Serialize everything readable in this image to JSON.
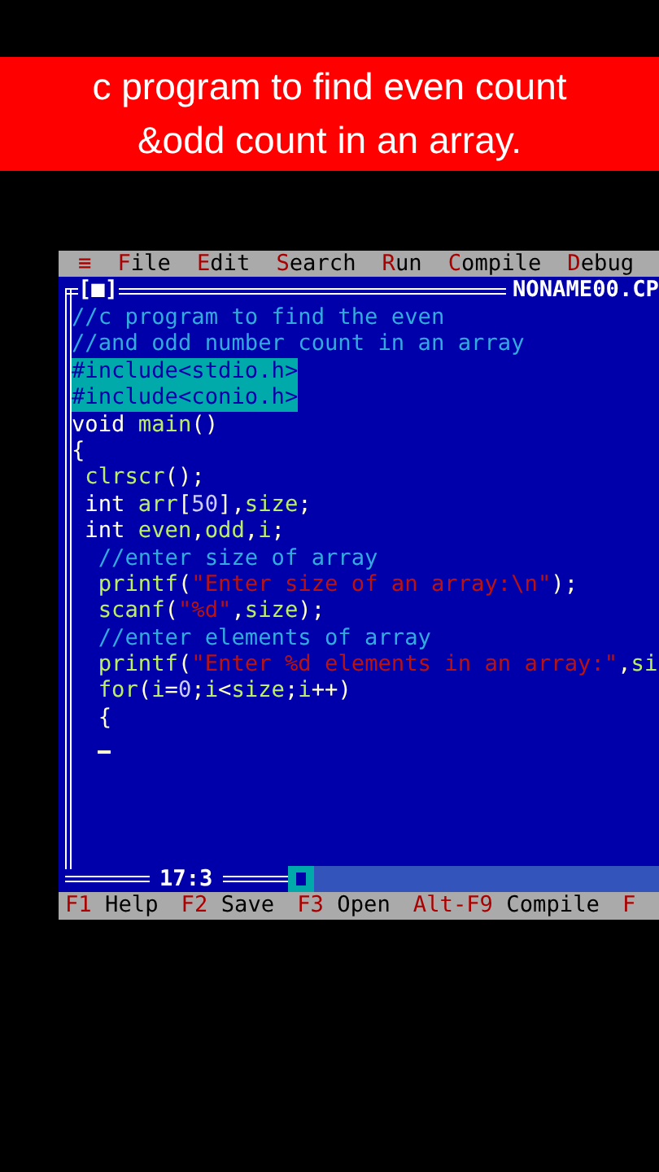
{
  "banner": {
    "lines": [
      "c program to find even count",
      "&odd count in an array."
    ]
  },
  "menu": [
    {
      "hot": "≡"
    },
    {
      "hot": "F",
      "rest": "ile"
    },
    {
      "hot": "E",
      "rest": "dit"
    },
    {
      "hot": "S",
      "rest": "earch"
    },
    {
      "hot": "R",
      "rest": "un"
    },
    {
      "hot": "C",
      "rest": "ompile"
    },
    {
      "hot": "D",
      "rest": "ebug"
    }
  ],
  "editor": {
    "close_box": "[■]",
    "file_name": "NONAME00.CP",
    "position": "17:3",
    "cursor_visible": true,
    "lines": [
      {
        "selected": false,
        "segments": [
          {
            "kind": "com",
            "text": "//c program to find the even"
          }
        ]
      },
      {
        "selected": false,
        "segments": [
          {
            "kind": "com",
            "text": "//and odd number count in an array"
          }
        ]
      },
      {
        "selected": true,
        "segments": [
          {
            "kind": "com",
            "text": "#include<stdio.h>"
          }
        ]
      },
      {
        "selected": true,
        "segments": [
          {
            "kind": "com",
            "text": "#include<conio.h>"
          }
        ]
      },
      {
        "selected": false,
        "segments": [
          {
            "kind": "kw",
            "text": "void "
          },
          {
            "kind": "id",
            "text": "main"
          },
          {
            "kind": "sym",
            "text": "()"
          }
        ]
      },
      {
        "selected": false,
        "segments": [
          {
            "kind": "sym",
            "text": "{"
          }
        ]
      },
      {
        "selected": false,
        "segments": [
          {
            "kind": "id",
            "text": " clrscr"
          },
          {
            "kind": "sym",
            "text": "();"
          }
        ]
      },
      {
        "selected": false,
        "segments": [
          {
            "kind": "kw",
            "text": " int "
          },
          {
            "kind": "id",
            "text": "arr"
          },
          {
            "kind": "sym",
            "text": "["
          },
          {
            "kind": "num",
            "text": "50"
          },
          {
            "kind": "sym",
            "text": "],"
          },
          {
            "kind": "id",
            "text": "size"
          },
          {
            "kind": "sym",
            "text": ";"
          }
        ]
      },
      {
        "selected": false,
        "segments": [
          {
            "kind": "kw",
            "text": " int "
          },
          {
            "kind": "id",
            "text": "even"
          },
          {
            "kind": "sym",
            "text": ","
          },
          {
            "kind": "id",
            "text": "odd"
          },
          {
            "kind": "sym",
            "text": ","
          },
          {
            "kind": "id",
            "text": "i"
          },
          {
            "kind": "sym",
            "text": ";"
          }
        ]
      },
      {
        "selected": false,
        "segments": [
          {
            "kind": "com",
            "text": "  //enter size of array"
          }
        ]
      },
      {
        "selected": false,
        "segments": [
          {
            "kind": "id",
            "text": "  printf"
          },
          {
            "kind": "sym",
            "text": "("
          },
          {
            "kind": "str",
            "text": "\"Enter size of an array:\\n\""
          },
          {
            "kind": "sym",
            "text": ");"
          }
        ]
      },
      {
        "selected": false,
        "segments": [
          {
            "kind": "id",
            "text": "  scanf"
          },
          {
            "kind": "sym",
            "text": "("
          },
          {
            "kind": "str",
            "text": "\"%d\""
          },
          {
            "kind": "sym",
            "text": ","
          },
          {
            "kind": "id",
            "text": "size"
          },
          {
            "kind": "sym",
            "text": ");"
          }
        ]
      },
      {
        "selected": false,
        "segments": [
          {
            "kind": "com",
            "text": "  //enter elements of array"
          }
        ]
      },
      {
        "selected": false,
        "segments": [
          {
            "kind": "id",
            "text": "  printf"
          },
          {
            "kind": "sym",
            "text": "("
          },
          {
            "kind": "str",
            "text": "\"Enter %d elements in an array:\""
          },
          {
            "kind": "sym",
            "text": ","
          },
          {
            "kind": "id",
            "text": "si"
          }
        ]
      },
      {
        "selected": false,
        "segments": [
          {
            "kind": "id",
            "text": "  for"
          },
          {
            "kind": "sym",
            "text": "("
          },
          {
            "kind": "id",
            "text": "i"
          },
          {
            "kind": "sym",
            "text": "="
          },
          {
            "kind": "num",
            "text": "0"
          },
          {
            "kind": "sym",
            "text": ";"
          },
          {
            "kind": "id",
            "text": "i"
          },
          {
            "kind": "sym",
            "text": "<"
          },
          {
            "kind": "id",
            "text": "size"
          },
          {
            "kind": "sym",
            "text": ";"
          },
          {
            "kind": "id",
            "text": "i"
          },
          {
            "kind": "sym",
            "text": "++)"
          }
        ]
      },
      {
        "selected": false,
        "segments": [
          {
            "kind": "sym",
            "text": "  {"
          }
        ]
      }
    ]
  },
  "status_bar": [
    {
      "key": "F1",
      "label": "Help"
    },
    {
      "key": "F2",
      "label": "Save"
    },
    {
      "key": "F3",
      "label": "Open"
    },
    {
      "key": "Alt-F9",
      "label": "Compile"
    },
    {
      "key": "F"
    }
  ]
}
